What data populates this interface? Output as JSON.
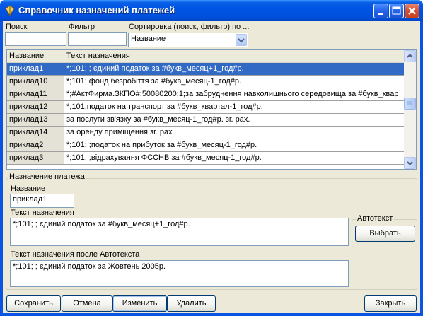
{
  "window": {
    "title": "Справочник назначений платежей",
    "accent": "#0054e3",
    "selection_color": "#316ac5"
  },
  "filters": {
    "search_label": "Поиск",
    "search_value": "",
    "filter_label": "Фильтр",
    "filter_value": "",
    "sort_label": "Сортировка (поиск, фильтр) по ...",
    "sort_selected": "Название"
  },
  "grid": {
    "columns": [
      "Название",
      "Текст назначения"
    ],
    "rows": [
      {
        "name": "приклад1",
        "text": "*;101; ; єдиний податок за #букв_месяц+1_год#р.",
        "selected": true
      },
      {
        "name": "приклад10",
        "text": "*;101; фонд безробіття  за  #букв_месяц-1_год#р."
      },
      {
        "name": "приклад11",
        "text": "*;#АктФирма.ЗКПО#;50080200;1;за забруднення навколишнього середовища за #букв_квар"
      },
      {
        "name": "приклад12",
        "text": "*;101;податок на транспорт за #букв_квартал-1_год#р."
      },
      {
        "name": "приклад13",
        "text": "за послуги зв'язку за #букв_месяц-1_год#р. зг. рах."
      },
      {
        "name": "приклад14",
        "text": "за оренду приміщення зг. рах"
      },
      {
        "name": "приклад2",
        "text": "*;101; ;податок на прибуток за #букв_месяц-1_год#р."
      },
      {
        "name": "приклад3",
        "text": "*;101; ;відрахування ФССНВ за #букв_месяц-1_год#р."
      }
    ]
  },
  "purpose": {
    "group_title": "Назначение платежа",
    "name_label": "Название",
    "name_value": "приклад1",
    "text_label": "Текст назначения",
    "text_value": "*;101; ; єдиний податок за #букв_месяц+1_год#р.",
    "autotext_group": "Автотекст",
    "choose_button": "Выбрать",
    "after_label": "Текст назначения после Автотекста",
    "after_value": "*;101; ; єдиний податок за Жовтень 2005р."
  },
  "buttons": {
    "save": "Сохранить",
    "cancel": "Отмена",
    "edit": "Изменить",
    "delete": "Удалить",
    "close": "Закрыть"
  }
}
